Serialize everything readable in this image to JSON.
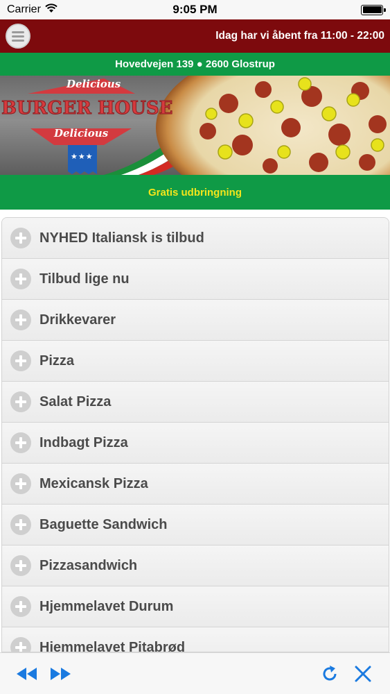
{
  "status_bar": {
    "carrier": "Carrier",
    "time": "9:05 PM",
    "icons": [
      "wifi-icon",
      "battery-icon"
    ]
  },
  "header": {
    "hours": "Idag har vi åbent fra 11:00 - 22:00",
    "menu_icon": "hamburger-menu-icon"
  },
  "address": "Hovedvejen 139 ● 2600 Glostrup",
  "banner": {
    "ribbon_top": "Delicious",
    "brand": "BURGER HOUSE",
    "ribbon_bottom": "Delicious",
    "stars": "★★★"
  },
  "delivery_text": "Gratis udbringning",
  "menu": {
    "items": [
      "NYHED Italiansk is tilbud",
      "Tilbud lige nu",
      "Drikkevarer",
      "Pizza",
      "Salat Pizza",
      "Indbagt Pizza",
      "Mexicansk Pizza",
      "Baguette Sandwich",
      "Pizzasandwich",
      "Hjemmelavet Durum",
      "Hjemmelavet Pitabrød"
    ],
    "expand_icon": "plus-circle-icon"
  },
  "toolbar": {
    "icons": [
      "back-icon",
      "forward-icon",
      "refresh-icon",
      "close-icon"
    ]
  },
  "colors": {
    "header_red": "#7d0a0d",
    "green": "#0f9a46",
    "delivery_text": "#f3e51c",
    "accent_blue": "#1a7ae0"
  }
}
